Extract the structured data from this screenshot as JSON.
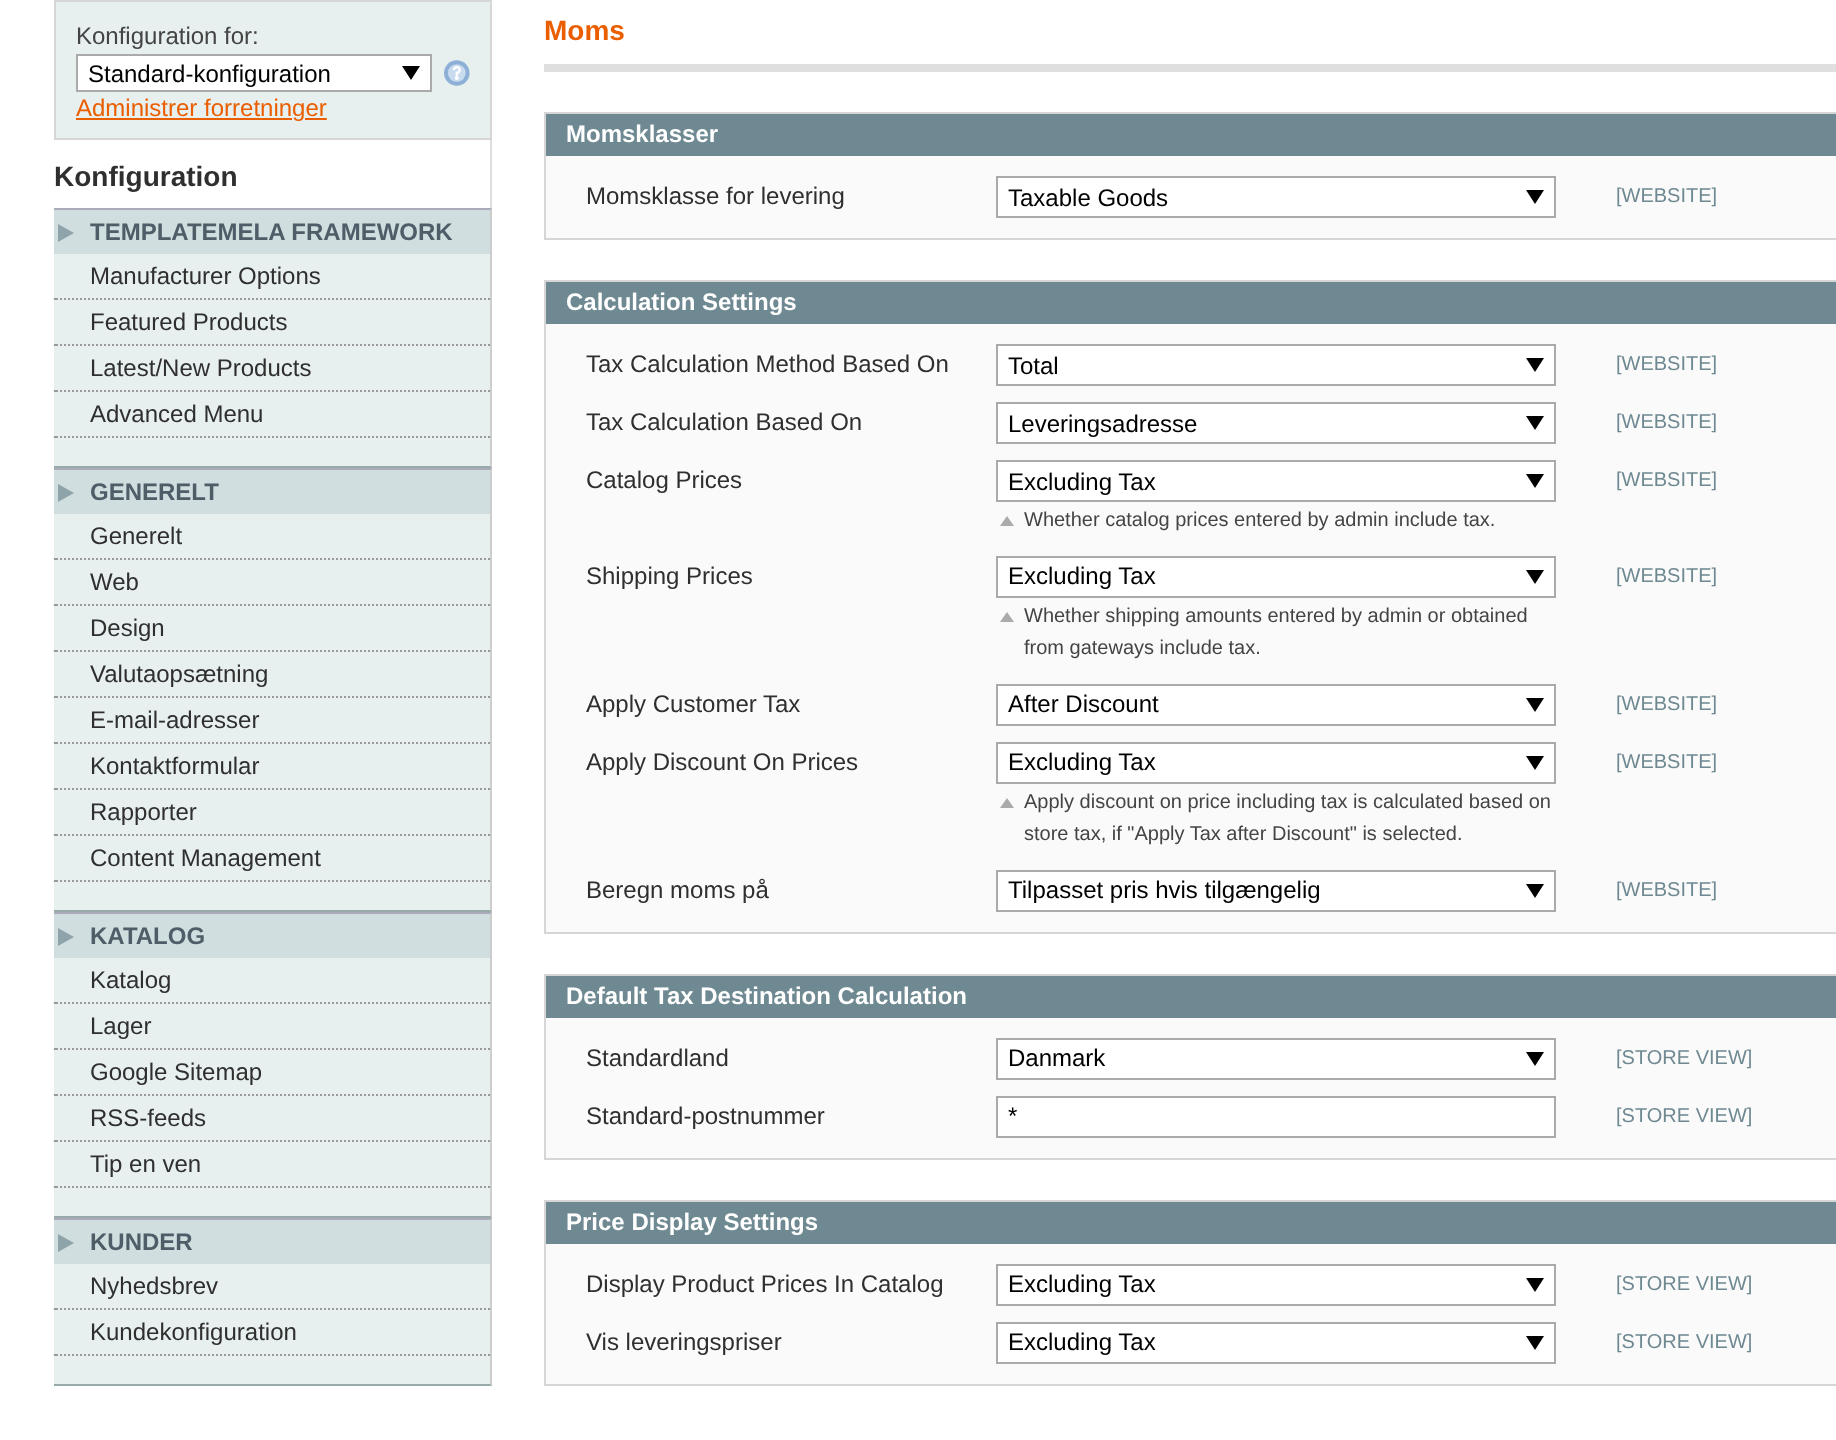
{
  "store_switcher": {
    "label": "Konfiguration for:",
    "value": "Standard-konfiguration",
    "link": "Administrer forretninger"
  },
  "sidebar": {
    "title": "Konfiguration",
    "groups": [
      {
        "title": "TEMPLATEMELA FRAMEWORK",
        "items": [
          "Manufacturer Options",
          "Featured Products",
          "Latest/New Products",
          "Advanced Menu"
        ]
      },
      {
        "title": "GENERELT",
        "items": [
          "Generelt",
          "Web",
          "Design",
          "Valutaopsætning",
          "E-mail-adresser",
          "Kontaktformular",
          "Rapporter",
          "Content Management"
        ]
      },
      {
        "title": "KATALOG",
        "items": [
          "Katalog",
          "Lager",
          "Google Sitemap",
          "RSS-feeds",
          "Tip en ven"
        ]
      },
      {
        "title": "KUNDER",
        "items": [
          "Nyhedsbrev",
          "Kundekonfiguration"
        ]
      }
    ]
  },
  "page_title": "Moms",
  "sections": [
    {
      "title": "Momsklasser",
      "rows": [
        {
          "label": "Momsklasse for levering",
          "kind": "select",
          "value": "Taxable Goods",
          "scope": "[WEBSITE]"
        }
      ]
    },
    {
      "title": "Calculation Settings",
      "rows": [
        {
          "label": "Tax Calculation Method Based On",
          "kind": "select",
          "value": "Total",
          "scope": "[WEBSITE]"
        },
        {
          "label": "Tax Calculation Based On",
          "kind": "select",
          "value": "Leveringsadresse",
          "scope": "[WEBSITE]"
        },
        {
          "label": "Catalog Prices",
          "kind": "select",
          "value": "Excluding Tax",
          "scope": "[WEBSITE]",
          "note": "Whether catalog prices entered by admin include tax."
        },
        {
          "label": "Shipping Prices",
          "kind": "select",
          "value": "Excluding Tax",
          "scope": "[WEBSITE]",
          "note": "Whether shipping amounts entered by admin or obtained from gateways include tax."
        },
        {
          "label": "Apply Customer Tax",
          "kind": "select",
          "value": "After Discount",
          "scope": "[WEBSITE]"
        },
        {
          "label": "Apply Discount On Prices",
          "kind": "select",
          "value": "Excluding Tax",
          "scope": "[WEBSITE]",
          "note": "Apply discount on price including tax is calculated based on store tax, if \"Apply Tax after Discount\" is selected."
        },
        {
          "label": "Beregn moms på",
          "kind": "select",
          "value": "Tilpasset pris hvis tilgængelig",
          "scope": "[WEBSITE]"
        }
      ]
    },
    {
      "title": "Default Tax Destination Calculation",
      "rows": [
        {
          "label": "Standardland",
          "kind": "select",
          "value": "Danmark",
          "scope": "[STORE VIEW]"
        },
        {
          "label": "Standard-postnummer",
          "kind": "text",
          "value": "*",
          "scope": "[STORE VIEW]"
        }
      ]
    },
    {
      "title": "Price Display Settings",
      "rows": [
        {
          "label": "Display Product Prices In Catalog",
          "kind": "select",
          "value": "Excluding Tax",
          "scope": "[STORE VIEW]"
        },
        {
          "label": "Vis leveringspriser",
          "kind": "select",
          "value": "Excluding Tax",
          "scope": "[STORE VIEW]"
        }
      ]
    }
  ]
}
